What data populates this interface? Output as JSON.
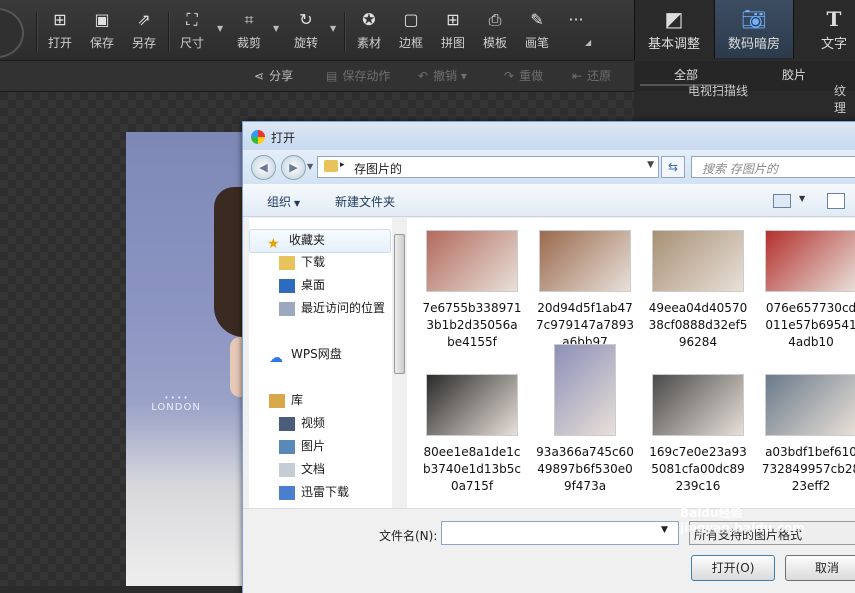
{
  "toolbar": {
    "open": "打开",
    "save": "保存",
    "save_as": "另存",
    "size": "尺寸",
    "crop": "裁剪",
    "rotate": "旋转",
    "material": "素材",
    "border": "边框",
    "collage": "拼图",
    "template": "模板",
    "brush": "画笔",
    "more": "···"
  },
  "right_tabs": {
    "basic": "基本调整",
    "digital_darkroom": "数码暗房",
    "text": "文字"
  },
  "subbar": {
    "share": "分享",
    "save_action": "保存动作",
    "undo": "撤销",
    "redo": "重做",
    "restore": "还原"
  },
  "right_sub": {
    "all": "全部",
    "film": "胶片",
    "item1": "电视扫描线",
    "item2": "纹理"
  },
  "photo": {
    "brand": "LONDON",
    "dots": "• • • •"
  },
  "dialog": {
    "title": "打开",
    "address_crumb": "存图片的",
    "search_placeholder": "搜索 存图片的",
    "organize": "组织",
    "new_folder": "新建文件夹",
    "nav": {
      "favorites": "收藏夹",
      "downloads": "下载",
      "desktop": "桌面",
      "recent": "最近访问的位置",
      "wps": "WPS网盘",
      "libraries": "库",
      "videos": "视频",
      "pictures": "图片",
      "documents": "文档",
      "thunder": "迅雷下载"
    },
    "files": [
      {
        "name": "7e6755b3389713b1b2d35056abe4155f",
        "l1": "7e6755b338971",
        "l2": "3b1b2d35056a",
        "l3": "be4155f",
        "color": "#b36a5d"
      },
      {
        "name": "20d94d5f1ab477c979147a7893a6bb97",
        "l1": "20d94d5f1ab47",
        "l2": "7c979147a7893",
        "l3": "a6bb97",
        "color": "#9a6a4e"
      },
      {
        "name": "49eea04d4057038cf0888d32ef596284",
        "l1": "49eea04d40570",
        "l2": "38cf0888d32ef5",
        "l3": "96284",
        "color": "#a89175"
      },
      {
        "name": "076e657730cd011e57b6954114adb10",
        "l1": "076e657730cd",
        "l2": "011e57b69541",
        "l3": "4adb10",
        "color": "#b3302e"
      },
      {
        "name": "80ee1e8a1de1cb3740e1d13b5c0a715f",
        "l1": "80ee1e8a1de1c",
        "l2": "b3740e1d13b5c",
        "l3": "0a715f",
        "color": "#2a2a2a"
      },
      {
        "name": "93a366a745c6049897b6f530e09f473a",
        "l1": "93a366a745c60",
        "l2": "49897b6f530e0",
        "l3": "9f473a",
        "color": "#8d8fb8"
      },
      {
        "name": "169c7e0e23a935081cfa00dc89239c16",
        "l1": "169c7e0e23a93",
        "l2": "5081cfa00dc89",
        "l3": "239c16",
        "color": "#4a4a4a"
      },
      {
        "name": "a03bdf1bef610732849957cb2823eff2",
        "l1": "a03bdf1bef610",
        "l2": "732849957cb28",
        "l3": "23eff2",
        "color": "#6a7a8a"
      }
    ],
    "filename_label": "文件名(N):",
    "filename_value": "",
    "filter_label": "所有支持的图片格式",
    "open_button": "打开(O)",
    "cancel_button": "取消"
  },
  "watermark": "Baidu经验 jingyan.baidu.com"
}
